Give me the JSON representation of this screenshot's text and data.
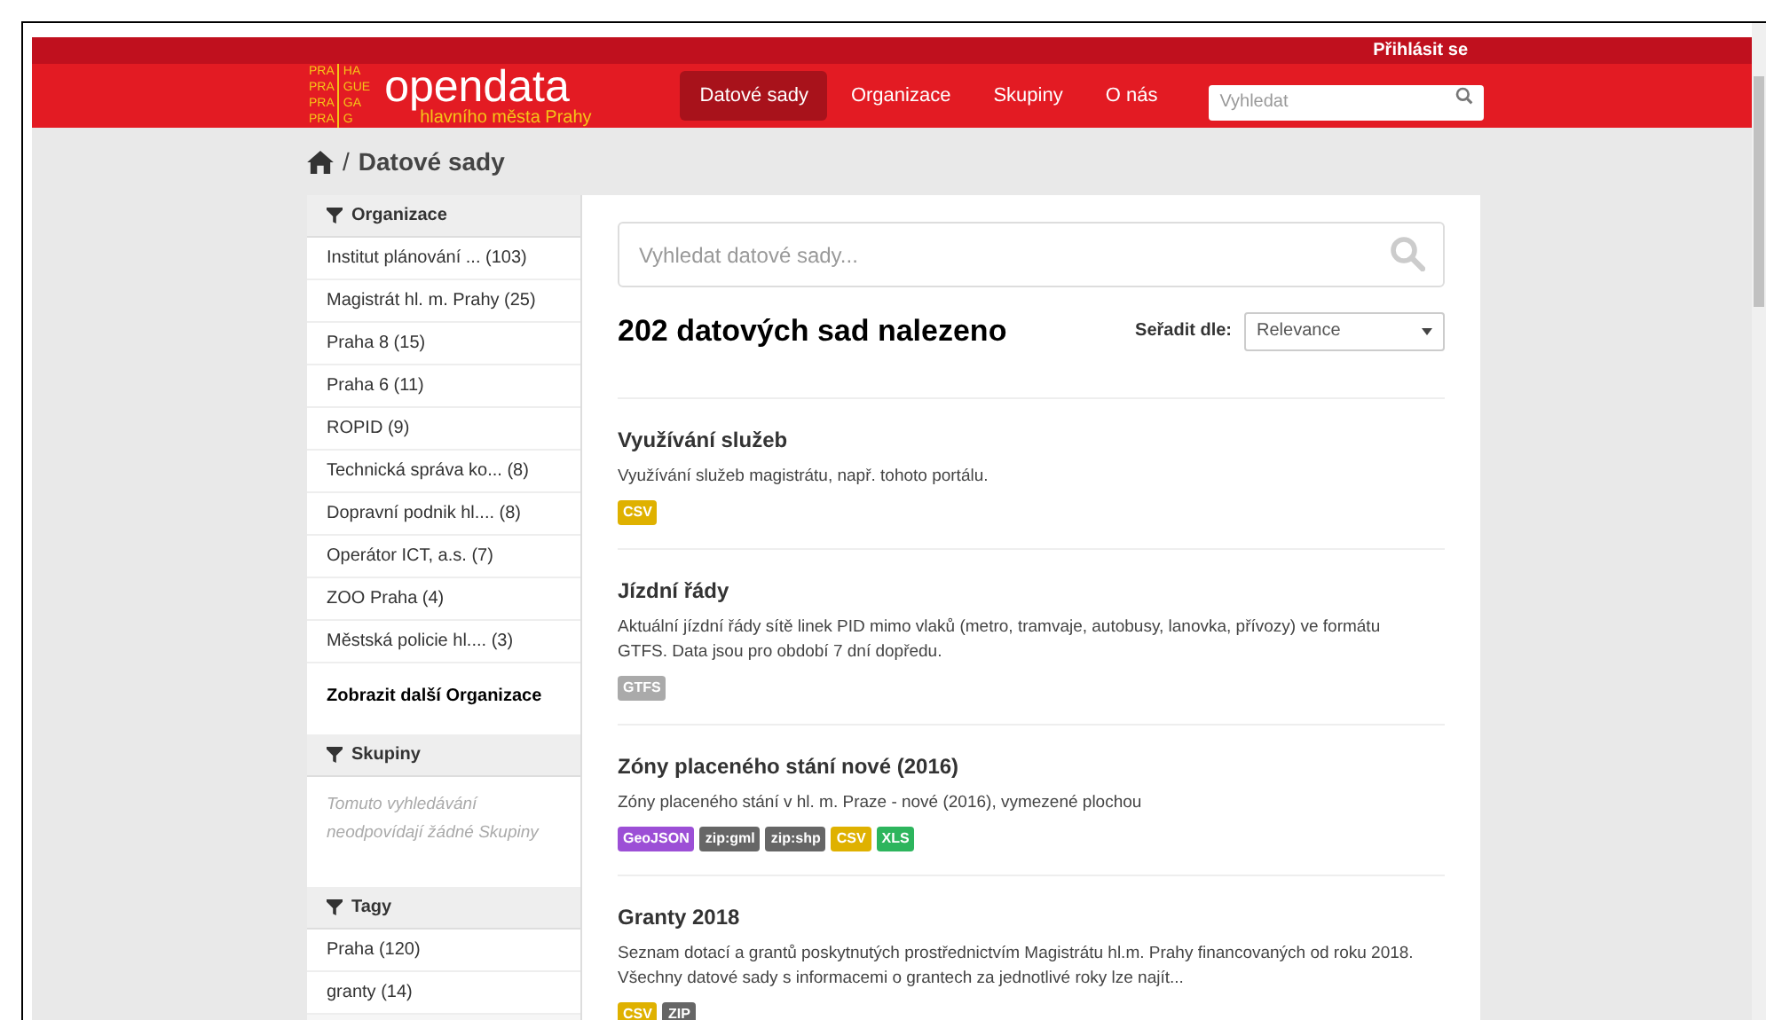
{
  "top_bar": {
    "login": "Přihlásit se"
  },
  "logo": {
    "grid": [
      [
        "PRA",
        "HA"
      ],
      [
        "PRA",
        "GUE"
      ],
      [
        "PRA",
        "GA"
      ],
      [
        "PRA",
        "G"
      ]
    ],
    "title": "opendata",
    "subtitle": "hlavního města Prahy"
  },
  "nav": [
    {
      "label": "Datové sady",
      "selected": true
    },
    {
      "label": "Organizace",
      "selected": false
    },
    {
      "label": "Skupiny",
      "selected": false
    },
    {
      "label": "O nás",
      "selected": false
    }
  ],
  "nav_search": {
    "placeholder": "Vyhledat"
  },
  "breadcrumb": {
    "separator": "/",
    "current": "Datové sady"
  },
  "facets": [
    {
      "title": "Organizace",
      "items": [
        "Institut plánování ... (103)",
        "Magistrát hl. m. Prahy (25)",
        "Praha 8 (15)",
        "Praha 6 (11)",
        "ROPID (9)",
        "Technická správa ko... (8)",
        "Dopravní podnik hl.... (8)",
        "Operátor ICT, a.s. (7)",
        "ZOO Praha (4)",
        "Městská policie hl.... (3)"
      ],
      "more": "Zobrazit další Organizace"
    },
    {
      "title": "Skupiny",
      "empty": "Tomuto vyhledávání neodpovídají žádné Skupiny"
    },
    {
      "title": "Tagy",
      "items": [
        "Praha (120)",
        "granty (14)"
      ]
    }
  ],
  "search": {
    "placeholder": "Vyhledat datové sady..."
  },
  "results_heading": "202 datových sad nalezeno",
  "sort": {
    "label": "Seřadit dle:",
    "value": "Relevance"
  },
  "datasets": [
    {
      "title": "Využívání služeb",
      "description": "Využívání služeb magistrátu, např. tohoto portálu.",
      "formats": [
        {
          "label": "CSV",
          "color": "#dfb100"
        }
      ]
    },
    {
      "title": "Jízdní řády",
      "description": "Aktuální jízdní řády sítě linek PID mimo vlaků (metro, tramvaje, autobusy, lanovka, přívozy) ve formátu GTFS. Data jsou pro období 7 dní dopředu.",
      "formats": [
        {
          "label": "GTFS",
          "color": "#aaaaaa"
        }
      ]
    },
    {
      "title": "Zóny placeného stání nové (2016)",
      "description": "Zóny placeného stání v hl. m. Praze - nové (2016), vymezené plochou",
      "formats": [
        {
          "label": "GeoJSON",
          "color": "#9c4fd6"
        },
        {
          "label": "zip:gml",
          "color": "#666666"
        },
        {
          "label": "zip:shp",
          "color": "#666666"
        },
        {
          "label": "CSV",
          "color": "#dfb100"
        },
        {
          "label": "XLS",
          "color": "#2db55d"
        }
      ]
    },
    {
      "title": "Granty 2018",
      "description": "Seznam dotací a grantů poskytnutých prostřednictvím Magistrátu hl.m. Prahy financovaných od roku 2018. Všechny datové sady s informacemi o grantech za jednotlivé roky lze najít...",
      "formats": [
        {
          "label": "CSV",
          "color": "#dfb100"
        },
        {
          "label": "ZIP",
          "color": "#666666"
        }
      ]
    }
  ]
}
